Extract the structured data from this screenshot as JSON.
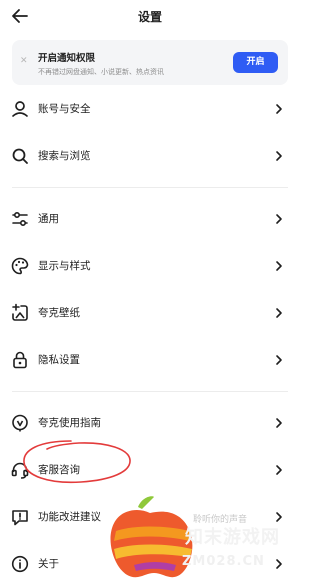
{
  "header": {
    "title": "设置",
    "back_icon": "back-arrow-icon"
  },
  "notice": {
    "title": "开启通知权限",
    "subtitle": "不再错过网盘通知、小说更新、热点资讯",
    "button": "开启",
    "accent": "#2f5cf4"
  },
  "groups": [
    {
      "items": [
        {
          "label": "账号与安全",
          "icon": "person-icon"
        },
        {
          "label": "搜索与浏览",
          "icon": "search-icon"
        }
      ]
    },
    {
      "items": [
        {
          "label": "通用",
          "icon": "sliders-icon"
        },
        {
          "label": "显示与样式",
          "icon": "palette-icon"
        },
        {
          "label": "夸克壁纸",
          "icon": "wallpaper-icon"
        },
        {
          "label": "隐私设置",
          "icon": "lock-icon"
        }
      ]
    },
    {
      "items": [
        {
          "label": "夸克使用指南",
          "icon": "guide-icon"
        },
        {
          "label": "客服咨询",
          "icon": "headset-icon"
        },
        {
          "label": "功能改进建议",
          "icon": "feedback-icon"
        },
        {
          "label": "关于",
          "icon": "info-icon"
        }
      ]
    }
  ],
  "watermark": {
    "big": "知末游戏网",
    "domain": "ZM028.CN",
    "small": "聆听你的声音"
  },
  "annotation_color": "#e33b3b"
}
